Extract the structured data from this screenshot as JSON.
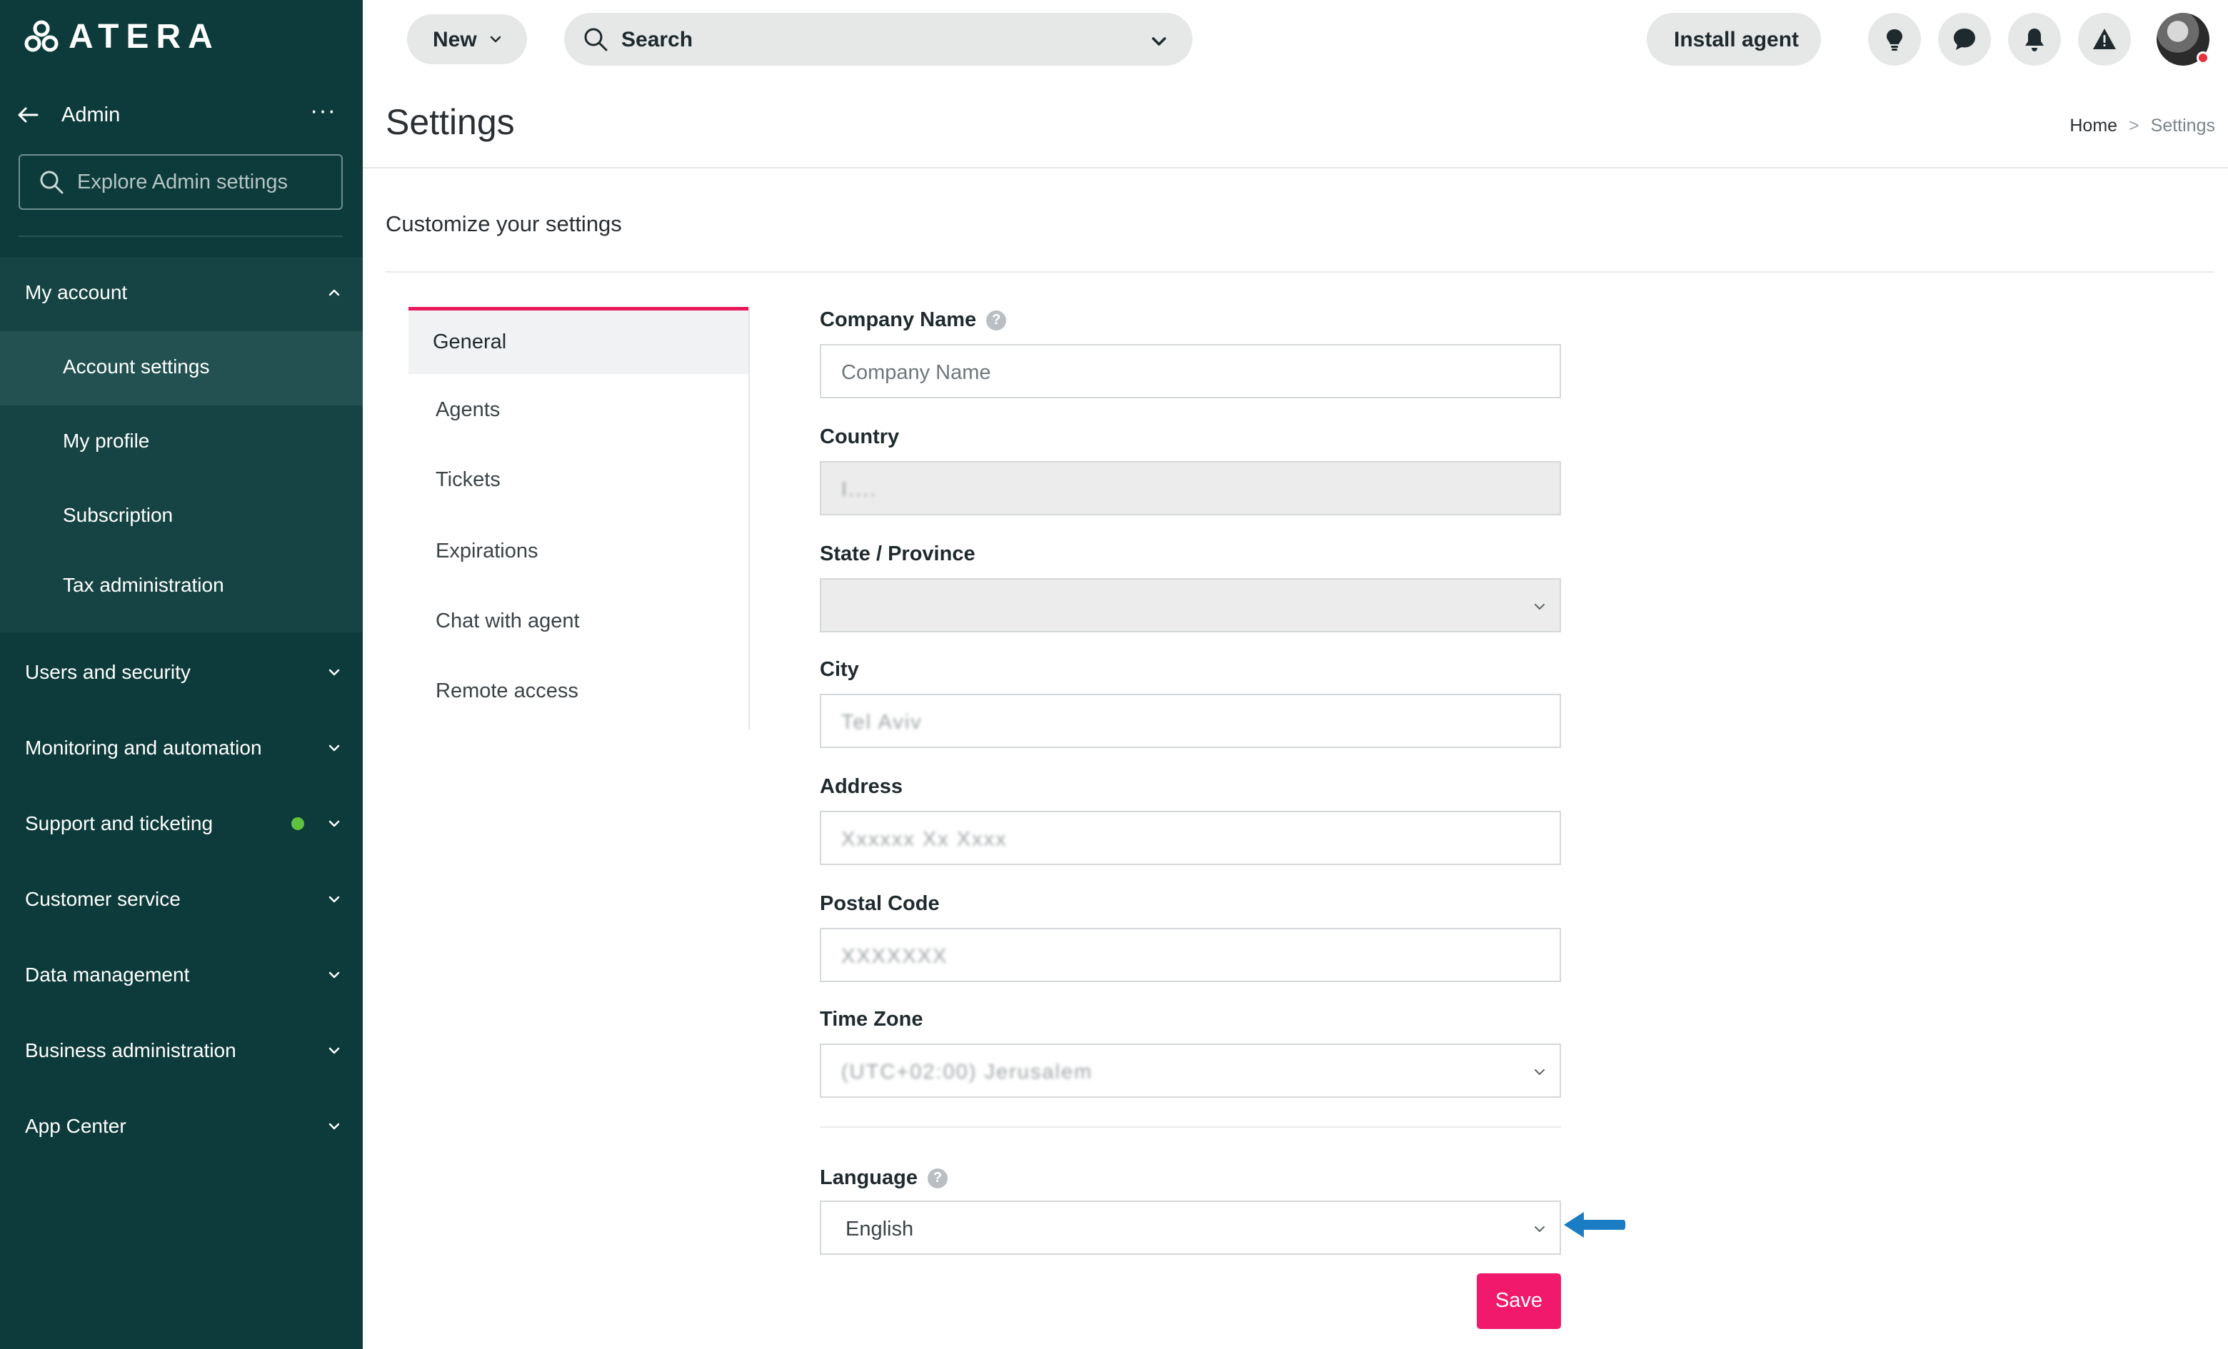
{
  "brand": {
    "logo_text": "ATERA"
  },
  "sidebar": {
    "back_label": "Admin",
    "more_label": "···",
    "search_placeholder": "Explore Admin settings",
    "my_account": {
      "label": "My account",
      "items": [
        {
          "label": "Account settings",
          "active": true
        },
        {
          "label": "My profile"
        },
        {
          "label": "Subscription"
        },
        {
          "label": "Tax administration"
        }
      ]
    },
    "groups": [
      {
        "label": "Users and security"
      },
      {
        "label": "Monitoring and automation"
      },
      {
        "label": "Support and ticketing",
        "has_dot": true
      },
      {
        "label": "Customer service"
      },
      {
        "label": "Data management"
      },
      {
        "label": "Business administration"
      },
      {
        "label": "App Center"
      }
    ]
  },
  "topbar": {
    "new_label": "New",
    "search_label": "Search",
    "install_label": "Install agent",
    "icons": [
      "lightbulb-icon",
      "chat-icon",
      "bell-icon",
      "alert-icon"
    ]
  },
  "header": {
    "title": "Settings",
    "breadcrumb": {
      "home": "Home",
      "separator": ">",
      "current": "Settings"
    },
    "subtitle": "Customize your settings"
  },
  "tabs": [
    {
      "label": "General",
      "active": true
    },
    {
      "label": "Agents"
    },
    {
      "label": "Tickets"
    },
    {
      "label": "Expirations"
    },
    {
      "label": "Chat with agent"
    },
    {
      "label": "Remote access"
    }
  ],
  "form": {
    "company_name": {
      "label": "Company Name",
      "placeholder": "Company Name",
      "value": ""
    },
    "country": {
      "label": "Country",
      "value": "I...."
    },
    "state": {
      "label": "State / Province",
      "value": ""
    },
    "city": {
      "label": "City",
      "value": "Tel Aviv"
    },
    "address": {
      "label": "Address",
      "value": "Xxxxxx Xx Xxxx"
    },
    "postal_code": {
      "label": "Postal Code",
      "value": "XXXXXXX"
    },
    "time_zone": {
      "label": "Time Zone",
      "value": "(UTC+02:00) Jerusalem"
    },
    "language": {
      "label": "Language",
      "value": "English"
    },
    "save_label": "Save"
  },
  "colors": {
    "sidebar_bg": "#0d3a3a",
    "accent": "#e8185a",
    "save": "#f0196b",
    "arrow": "#1a7dc4",
    "dot": "#5fc23c"
  }
}
